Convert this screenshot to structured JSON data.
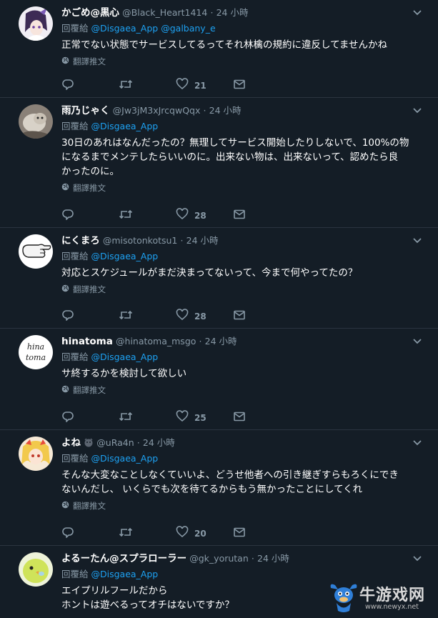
{
  "tweets": [
    {
      "display_name": "かごめ@黒心",
      "handle": "@Black_Heart1414",
      "separator": "·",
      "time": "24 小時",
      "reply_label": "回覆給",
      "mentions": [
        "@Disgaea_App",
        "@galbany_e"
      ],
      "text": "正常でない状態でサービスしてるってそれ林檎の規約に違反してませんかね",
      "translate_label": "翻譯推文",
      "like_count": "21",
      "retweet_count": "",
      "reply_count": ""
    },
    {
      "display_name": "雨乃じゃく",
      "handle": "@Jw3jM3xJrcqwQqx",
      "separator": "·",
      "time": "24 小時",
      "reply_label": "回覆給",
      "mentions": [
        "@Disgaea_App"
      ],
      "text": "30日のあれはなんだったの？無理してサービス開始したりしないで、100%の物\nになるまでメンテしたらいいのに。出来ない物は、出来ないって、認めたら良\nかったのに。",
      "translate_label": "翻譯推文",
      "like_count": "28",
      "retweet_count": "",
      "reply_count": ""
    },
    {
      "display_name": "にくまろ",
      "handle": "@misotonkotsu1",
      "separator": "·",
      "time": "24 小時",
      "reply_label": "回覆給",
      "mentions": [
        "@Disgaea_App"
      ],
      "text": "対応とスケジュールがまだ決まってないって、今まで何やってたの？",
      "translate_label": "翻譯推文",
      "like_count": "28",
      "retweet_count": "",
      "reply_count": ""
    },
    {
      "display_name": "hinatoma",
      "handle": "@hinatoma_msgo",
      "separator": "·",
      "time": "24 小時",
      "reply_label": "回覆給",
      "mentions": [
        "@Disgaea_App"
      ],
      "text": "サ終するかを検討して欲しい",
      "translate_label": "翻譯推文",
      "like_count": "25",
      "retweet_count": "",
      "reply_count": ""
    },
    {
      "display_name": "よね",
      "handle": "@uRa4n",
      "separator": "·",
      "time": "24 小時",
      "reply_label": "回覆給",
      "mentions": [
        "@Disgaea_App"
      ],
      "text": "そんな大変なことしなくていいよ、どうせ他者への引き継ぎすらもろくにでき\nないんだし、 いくらでも次を待てるからもう無かったことにしてくれ",
      "translate_label": "翻譯推文",
      "like_count": "20",
      "retweet_count": "",
      "reply_count": ""
    },
    {
      "display_name": "よるーたん@スプラローラー",
      "handle": "@gk_yorutan",
      "separator": "·",
      "time": "24 小時",
      "reply_label": "回覆給",
      "mentions": [
        "@Disgaea_App"
      ],
      "text": "エイプリルフールだから\nホントは遊べるってオチはないですか？",
      "translate_label": "",
      "like_count": "",
      "retweet_count": "",
      "reply_count": ""
    }
  ],
  "avatar_texts": {
    "hinatoma": [
      "hina",
      "toma"
    ]
  },
  "watermark": {
    "logo_text": "牛游戏网",
    "url": "www.newyx.net"
  },
  "colors": {
    "background": "#141d26",
    "divider": "#2b3440",
    "muted": "#8899a6",
    "link": "#1da1f2",
    "text": "#ffffff"
  },
  "icons": {
    "reply": "reply-icon",
    "retweet": "retweet-icon",
    "like": "heart-icon",
    "dm": "envelope-icon",
    "translate": "globe-icon",
    "caret": "chevron-down-icon"
  }
}
